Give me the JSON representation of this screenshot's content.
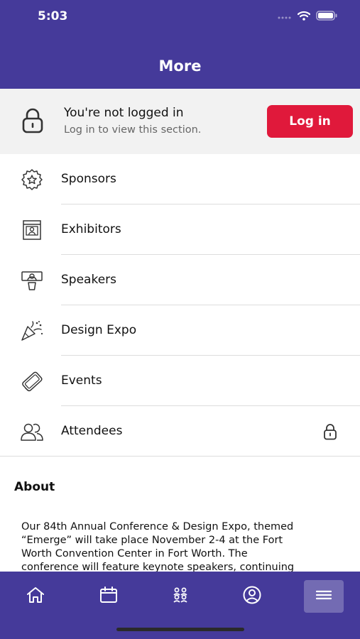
{
  "status_bar": {
    "time": "5:03"
  },
  "nav": {
    "title": "More"
  },
  "login_banner": {
    "title": "You're not logged in",
    "subtitle": "Log in to view this section.",
    "button_label": "Log in",
    "button_color": "#E0193B"
  },
  "menu": {
    "items": [
      {
        "label": "Sponsors",
        "icon": "badge-star-icon",
        "locked": false
      },
      {
        "label": "Exhibitors",
        "icon": "booth-icon",
        "locked": false
      },
      {
        "label": "Speakers",
        "icon": "podium-speaker-icon",
        "locked": false
      },
      {
        "label": "Design Expo",
        "icon": "party-popper-icon",
        "locked": false
      },
      {
        "label": "Events",
        "icon": "ticket-icon",
        "locked": false
      },
      {
        "label": "Attendees",
        "icon": "people-icon",
        "locked": true
      }
    ]
  },
  "about": {
    "title": "About",
    "lines": [
      "Our 84th Annual Conference & Design Expo, themed",
      "“Emerge” will take place November 2-4 at the Fort",
      "Worth Convention Center in Fort Worth. The",
      "conference will feature keynote speakers, continuing"
    ]
  },
  "tab_bar": {
    "tabs": [
      {
        "icon": "home-icon",
        "active": false
      },
      {
        "icon": "calendar-icon",
        "active": false
      },
      {
        "icon": "people-group-icon",
        "active": false
      },
      {
        "icon": "profile-icon",
        "active": false
      },
      {
        "icon": "menu-icon",
        "active": true
      }
    ]
  },
  "colors": {
    "brand": "#453A9A",
    "accent": "#E0193B",
    "banner_bg": "#F2F2F2"
  }
}
